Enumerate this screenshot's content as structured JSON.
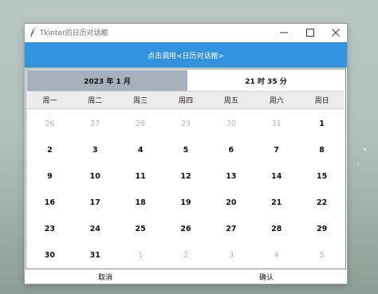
{
  "window": {
    "title": "Tkinter的日历对话框",
    "controls": [
      "minimize-icon",
      "maximize-icon",
      "close-icon"
    ]
  },
  "trigger_label": "点击调用<日历对话框>",
  "calendar": {
    "month_label": "2023 年 1 月",
    "time_label": "21 时 35 分",
    "weekdays": [
      "周一",
      "周二",
      "周三",
      "周四",
      "周五",
      "周六",
      "周日"
    ],
    "days": [
      {
        "d": "26",
        "current": false
      },
      {
        "d": "27",
        "current": false
      },
      {
        "d": "28",
        "current": false
      },
      {
        "d": "29",
        "current": false
      },
      {
        "d": "30",
        "current": false
      },
      {
        "d": "31",
        "current": false
      },
      {
        "d": "1",
        "current": true
      },
      {
        "d": "2",
        "current": true
      },
      {
        "d": "3",
        "current": true
      },
      {
        "d": "4",
        "current": true
      },
      {
        "d": "5",
        "current": true
      },
      {
        "d": "6",
        "current": true
      },
      {
        "d": "7",
        "current": true
      },
      {
        "d": "8",
        "current": true
      },
      {
        "d": "9",
        "current": true
      },
      {
        "d": "10",
        "current": true
      },
      {
        "d": "11",
        "current": true
      },
      {
        "d": "12",
        "current": true
      },
      {
        "d": "13",
        "current": true
      },
      {
        "d": "14",
        "current": true
      },
      {
        "d": "15",
        "current": true
      },
      {
        "d": "16",
        "current": true
      },
      {
        "d": "17",
        "current": true
      },
      {
        "d": "18",
        "current": true
      },
      {
        "d": "19",
        "current": true
      },
      {
        "d": "20",
        "current": true
      },
      {
        "d": "21",
        "current": true
      },
      {
        "d": "22",
        "current": true
      },
      {
        "d": "23",
        "current": true
      },
      {
        "d": "24",
        "current": true
      },
      {
        "d": "25",
        "current": true
      },
      {
        "d": "26",
        "current": true
      },
      {
        "d": "27",
        "current": true
      },
      {
        "d": "28",
        "current": true
      },
      {
        "d": "29",
        "current": true
      },
      {
        "d": "30",
        "current": true
      },
      {
        "d": "31",
        "current": true
      },
      {
        "d": "1",
        "current": false
      },
      {
        "d": "2",
        "current": false
      },
      {
        "d": "3",
        "current": false
      },
      {
        "d": "4",
        "current": false
      },
      {
        "d": "5",
        "current": false
      }
    ]
  },
  "actions": {
    "cancel_label": "取消",
    "confirm_label": "确认"
  },
  "colors": {
    "trigger_bg": "#3192e0",
    "month_header_bg": "#a6b0bd",
    "weekday_row_bg": "#ececec",
    "other_month_text": "#b7b7b7"
  }
}
